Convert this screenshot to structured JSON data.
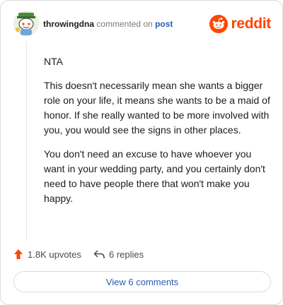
{
  "header": {
    "username": "throwingdna",
    "action": "commented on",
    "post_link": "post",
    "logo_text": "reddit"
  },
  "comment": {
    "paragraphs": [
      "NTA",
      "This doesn't necessarily mean she wants a bigger role on your life, it means she wants to be a maid of honor. If she really wanted to be more involved with you, you would see the signs in other places.",
      "You don't need an excuse to have whoever you want in your wedding party, and you certainly don't need to have people there that won't make you happy."
    ]
  },
  "actions": {
    "upvotes": "1.8K upvotes",
    "replies": "6 replies"
  },
  "footer": {
    "view_comments": "View 6 comments"
  },
  "colors": {
    "reddit_orange": "#ff4500",
    "link_blue": "#2a5db0"
  },
  "icons": {
    "avatar": "snoo-avatar",
    "logo": "reddit-logo-icon",
    "upvote": "upvote-arrow-icon",
    "reply": "reply-arrow-icon"
  }
}
